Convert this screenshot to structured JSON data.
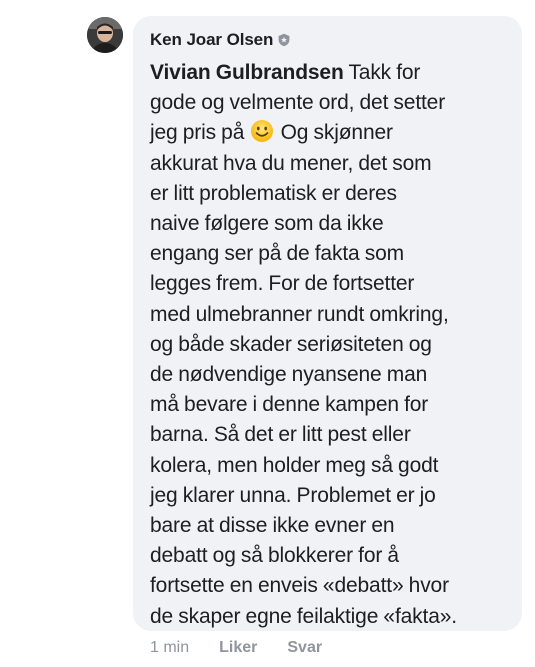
{
  "comment": {
    "author": "Ken Joar Olsen",
    "author_badge_icon": "shield-badge-icon",
    "mention": "Vivian Gulbrandsen",
    "text_lines": [
      " Takk for",
      "gode og velmente ord, det setter",
      "jeg pris på ",
      " Og skjønner",
      "akkurat hva du mener, det som",
      "er litt problematisk er deres",
      "naive følgere som da ikke",
      "engang ser på de fakta som",
      "legges frem. For de fortsetter",
      "med ulmebranner rundt omkring,",
      "og både skader seriøsiteten og",
      "de nødvendige nyansene man",
      "må bevare i denne kampen for",
      "barna. Så det er litt pest eller",
      "kolera, men holder meg så godt",
      "jeg klarer unna. Problemet er jo",
      "bare at disse ikke evner en",
      "debatt og så blokkerer for å",
      "fortsette en enveis «debatt» hvor",
      "de skaper egne feilaktige «fakta»."
    ],
    "emoji": "slightly-smiling-face-icon",
    "time": "1 min",
    "like_label": "Liker",
    "reply_label": "Svar"
  },
  "colors": {
    "bubble": "#f0f2f5",
    "text": "#1c1e21",
    "meta": "#90949c"
  }
}
